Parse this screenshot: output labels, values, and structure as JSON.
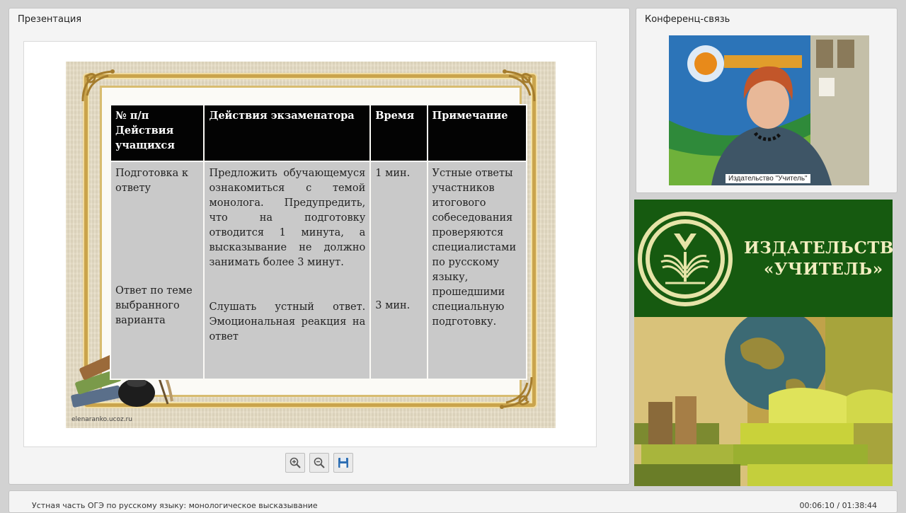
{
  "presentation": {
    "title": "Презентация",
    "slide": {
      "watermark": "elenaranko.ucoz.ru",
      "table": {
        "headers": [
          "№ п/п Действия учащихся",
          "Действия экзаменатора",
          "Время",
          "Примечание"
        ],
        "rows": [
          {
            "student_1": "Подготовка к ответу",
            "student_2": "Ответ по теме выбранного варианта",
            "examiner_1": "Предложить обучающемуся ознакомиться с темой монолога. Предупредить, что на подготовку отводится 1 минута, а высказывание не должно занимать более 3 минут.",
            "examiner_2": "Слушать устный ответ. Эмоциональная реакция на ответ",
            "time_1": "1 мин.",
            "time_2": "3 мин.",
            "note": "Устные ответы участников итогового собеседования проверяются специалистами по русскому языку, прошедшими специальную подготовку."
          }
        ]
      }
    },
    "toolbar": {
      "zoom_in_icon": "zoom-in-icon",
      "zoom_out_icon": "zoom-out-icon",
      "save_icon": "save-icon"
    }
  },
  "conference": {
    "title": "Конференц-связь",
    "speaker_label": "Издательство \"Учитель\""
  },
  "banner": {
    "line1": "ИЗДАТЕЛЬСТВО",
    "line2": "«УЧИТЕЛЬ»"
  },
  "footer": {
    "course_title": "Устная часть ОГЭ по русскому языку: монологическое высказывание",
    "timer": "00:06:10 / 01:38:44"
  }
}
